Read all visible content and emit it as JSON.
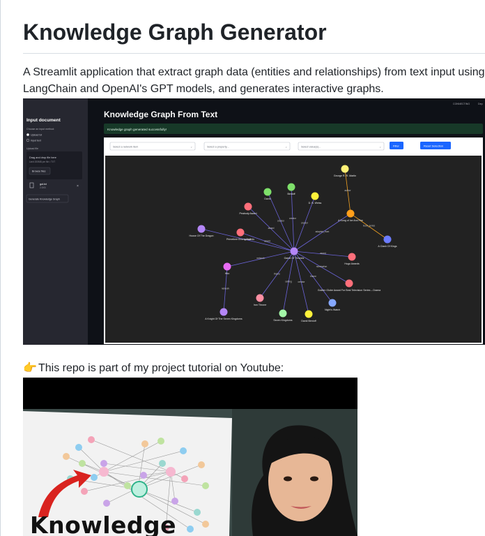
{
  "readme": {
    "title": "Knowledge Graph Generator",
    "intro_line1": "A Streamlit application that extract graph data (entities and relationships) from text input using",
    "intro_line2": "LangChain and OpenAI's GPT models, and generates interactive graphs.",
    "youtube_pointer": "👉",
    "youtube_text": "This repo is part of my project tutorial on Youtube:"
  },
  "app": {
    "sidebar_title": "Input document",
    "input_method_label": "Choose an input method:",
    "radio_upload": "Upload txt",
    "radio_input": "Input text",
    "upload_label": "Upload file",
    "drop_text": "Drag and drop file here",
    "limit_text": "Limit 200MB per file • TXT",
    "browse_label": "Browse files",
    "file_name": "got.txt",
    "file_size": "2.0KB",
    "generate_label": "Generate Knowledge Graph",
    "topbar_status": "CONNECTING",
    "topbar_more": "Dep",
    "main_title": "Knowledge Graph From Text",
    "success_message": "Knowledge graph generated successfully!",
    "select_network": "Select a network item",
    "select_property": "Select a property...",
    "select_value": "Select value(s)...",
    "filter_label": "Filter",
    "reset_label": "Reset Selection",
    "accent_color": "#1a66ff",
    "success_bg": "#173928"
  },
  "graph": {
    "nodes": [
      {
        "id": "grrm",
        "label": "George R. R. Martin",
        "color": "#fff176"
      },
      {
        "id": "asoiaf",
        "label": "A Song of Ice And Fire",
        "color": "#ff9f1a"
      },
      {
        "id": "clash",
        "label": "A Clash Of Kings",
        "color": "#6c7cff"
      },
      {
        "id": "got",
        "label": "Game Of Thrones",
        "color": "#b486f7"
      },
      {
        "id": "david",
        "label": "David",
        "color": "#7ee06a"
      },
      {
        "id": "benioff",
        "label": "Benioff",
        "color": "#7ee06a"
      },
      {
        "id": "weiss",
        "label": "D. B. Weiss",
        "color": "#fff23a"
      },
      {
        "id": "peabody",
        "label": "Peabody Award",
        "color": "#ff6f7a"
      },
      {
        "id": "primetime",
        "label": "Primetime Emmy Awards",
        "color": "#ff6f7a"
      },
      {
        "id": "house",
        "label": "House Of The Dragon",
        "color": "#b486f7"
      },
      {
        "id": "hugo",
        "label": "Hugo Awards",
        "color": "#ff6f7a"
      },
      {
        "id": "golden",
        "label": "Golden Globe Award For Best Television Series – Drama",
        "color": "#ff6f7a"
      },
      {
        "id": "hbo",
        "label": "Hbo",
        "color": "#e86bf3"
      },
      {
        "id": "iron",
        "label": "Iron Throne",
        "color": "#ff8fa3"
      },
      {
        "id": "nights",
        "label": "Night's Watch",
        "color": "#86a8ff"
      },
      {
        "id": "seven",
        "label": "Seven Kingdoms",
        "color": "#a3f7a8"
      },
      {
        "id": "knight",
        "label": "A Knight Of The Seven Kingdoms",
        "color": "#b486f7"
      },
      {
        "id": "david2",
        "label": "David Benioff",
        "color": "#fff23a"
      }
    ],
    "edges": [
      {
        "from": "grrm",
        "to": "asoiaf",
        "label": "author"
      },
      {
        "from": "asoiaf",
        "to": "clash",
        "label": "book_series"
      },
      {
        "from": "got",
        "to": "asoiaf",
        "label": "adapted_from"
      },
      {
        "from": "got",
        "to": "david",
        "label": "creator"
      },
      {
        "from": "got",
        "to": "benioff",
        "label": "creator"
      },
      {
        "from": "got",
        "to": "weiss",
        "label": "creator"
      },
      {
        "from": "got",
        "to": "peabody",
        "label": "award"
      },
      {
        "from": "got",
        "to": "primetime",
        "label": "award"
      },
      {
        "from": "got",
        "to": "house",
        "label": "spinoff"
      },
      {
        "from": "got",
        "to": "hugo",
        "label": "award"
      },
      {
        "from": "got",
        "to": "golden",
        "label": "nomination"
      },
      {
        "from": "got",
        "to": "hbo",
        "label": "network"
      },
      {
        "from": "got",
        "to": "iron",
        "label": "theme"
      },
      {
        "from": "got",
        "to": "nights",
        "label": "theme"
      },
      {
        "from": "got",
        "to": "seven",
        "label": "setting"
      },
      {
        "from": "got",
        "to": "david2",
        "label": "creator"
      },
      {
        "from": "hbo",
        "to": "knight",
        "label": "network"
      }
    ]
  }
}
